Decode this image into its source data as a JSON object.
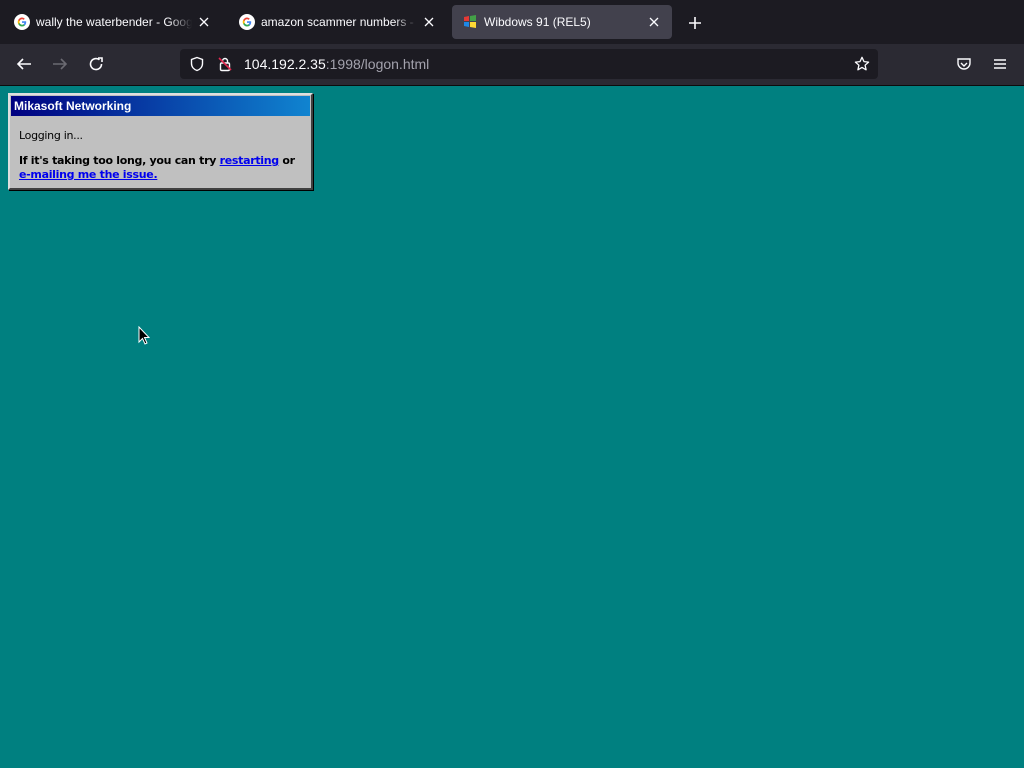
{
  "browser": {
    "tabs": [
      {
        "title": "wally the waterbender - Google Search",
        "favicon": "google-g-icon",
        "active": false
      },
      {
        "title": "amazon scammer numbers - Google Search",
        "favicon": "google-g-icon",
        "active": false
      },
      {
        "title": "Wibdows 91 (REL5)",
        "favicon": "windows-logo-icon",
        "active": true
      }
    ],
    "url": {
      "host": "104.192.2.35",
      "rest": ":1998/logon.html"
    }
  },
  "dialog": {
    "title": "Mikasoft Networking",
    "status": "Logging in...",
    "help_prefix": "If it's taking too long, you can try ",
    "restart_link": "restarting",
    "help_or": " or",
    "email_link": "e-mailing me the issue."
  },
  "colors": {
    "desktop": "#008080",
    "titlebar_start": "#000080",
    "titlebar_end": "#1084d0",
    "dialog_face": "#c0c0c0",
    "link": "#0000ee"
  }
}
